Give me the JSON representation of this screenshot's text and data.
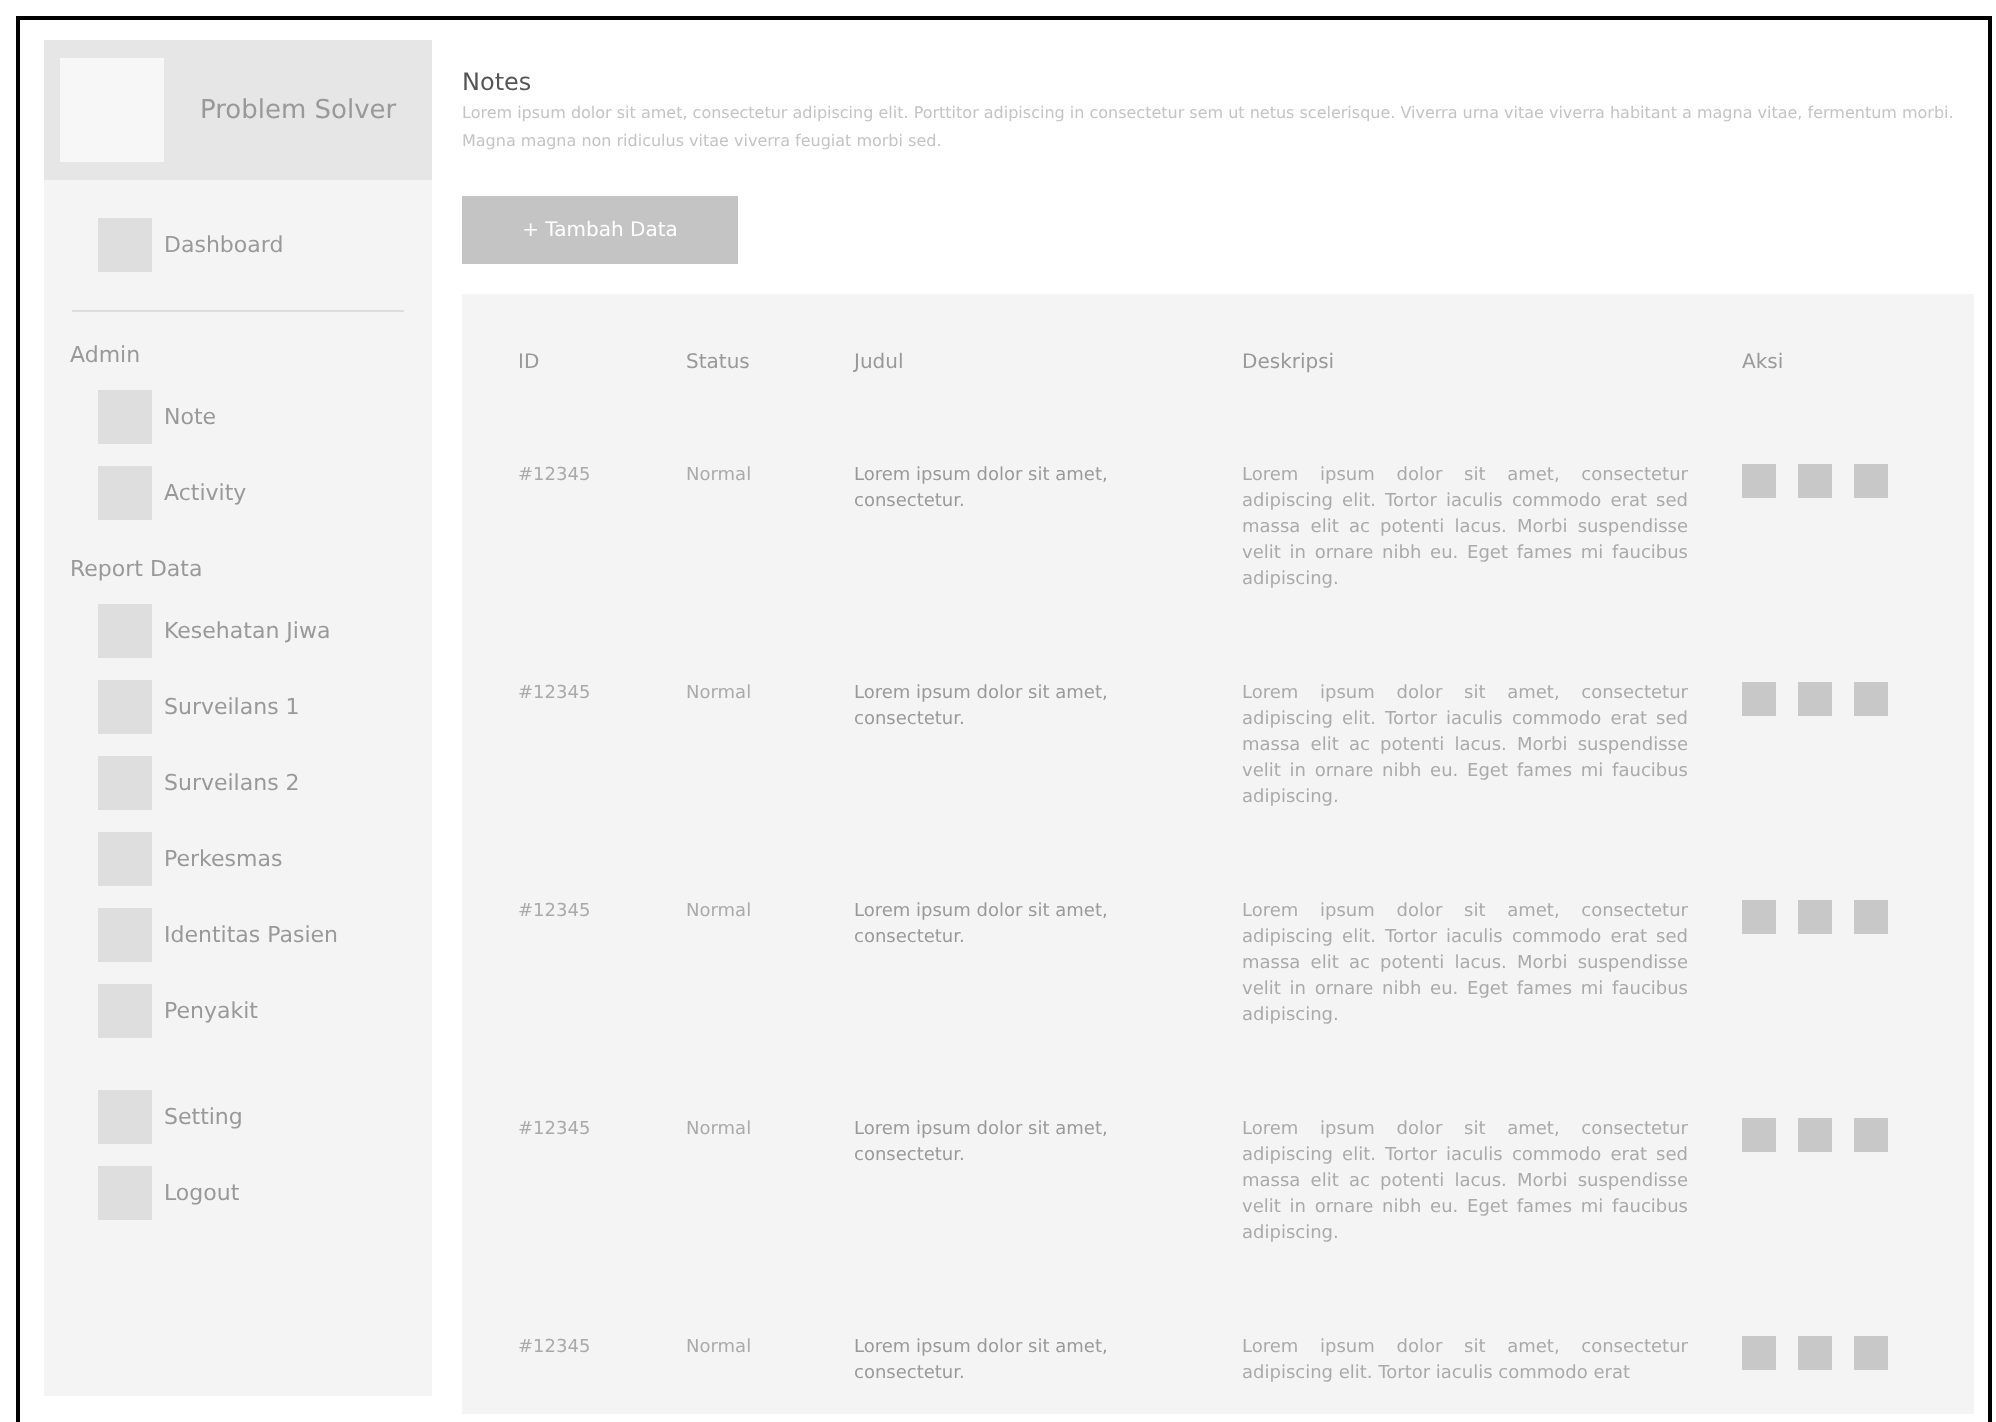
{
  "sidebar": {
    "logo": "Problem Solver",
    "top_items": [
      {
        "label": "Dashboard"
      }
    ],
    "sections": [
      {
        "title": "Admin",
        "items": [
          {
            "label": "Note"
          },
          {
            "label": "Activity"
          }
        ]
      },
      {
        "title": "Report Data",
        "items": [
          {
            "label": "Kesehatan Jiwa"
          },
          {
            "label": "Surveilans 1"
          },
          {
            "label": "Surveilans 2"
          },
          {
            "label": "Perkesmas"
          },
          {
            "label": "Identitas Pasien"
          },
          {
            "label": "Penyakit"
          }
        ]
      }
    ],
    "bottom_items": [
      {
        "label": "Setting"
      },
      {
        "label": "Logout"
      }
    ]
  },
  "page": {
    "title": "Notes",
    "description": "Lorem ipsum dolor sit amet, consectetur adipiscing elit. Porttitor adipiscing in consectetur sem ut netus scelerisque. Viverra urna vitae viverra habitant a magna vitae, fermentum morbi. Magna magna non ridiculus vitae viverra feugiat morbi sed.",
    "add_button": "+ Tambah Data"
  },
  "table": {
    "columns": [
      "ID",
      "Status",
      "Judul",
      "Deskripsi",
      "Aksi"
    ],
    "rows": [
      {
        "id": "#12345",
        "status": "Normal",
        "title": "Lorem ipsum dolor sit amet, consectetur.",
        "description": "Lorem ipsum dolor sit amet, consectetur adipiscing elit. Tortor iaculis commodo erat sed massa elit ac potenti lacus. Morbi suspendisse velit in ornare nibh eu. Eget fames mi faucibus adipiscing."
      },
      {
        "id": "#12345",
        "status": "Normal",
        "title": "Lorem ipsum dolor sit amet, consectetur.",
        "description": "Lorem ipsum dolor sit amet, consectetur adipiscing elit. Tortor iaculis commodo erat sed massa elit ac potenti lacus. Morbi suspendisse velit in ornare nibh eu. Eget fames mi faucibus adipiscing."
      },
      {
        "id": "#12345",
        "status": "Normal",
        "title": "Lorem ipsum dolor sit amet, consectetur.",
        "description": "Lorem ipsum dolor sit amet, consectetur adipiscing elit. Tortor iaculis commodo erat sed massa elit ac potenti lacus. Morbi suspendisse velit in ornare nibh eu. Eget fames mi faucibus adipiscing."
      },
      {
        "id": "#12345",
        "status": "Normal",
        "title": "Lorem ipsum dolor sit amet, consectetur.",
        "description": "Lorem ipsum dolor sit amet, consectetur adipiscing elit. Tortor iaculis commodo erat sed massa elit ac potenti lacus. Morbi suspendisse velit in ornare nibh eu. Eget fames mi faucibus adipiscing."
      },
      {
        "id": "#12345",
        "status": "Normal",
        "title": "Lorem ipsum dolor sit amet, consectetur.",
        "description": "Lorem ipsum dolor sit amet, consectetur adipiscing elit. Tortor iaculis commodo erat"
      }
    ]
  }
}
